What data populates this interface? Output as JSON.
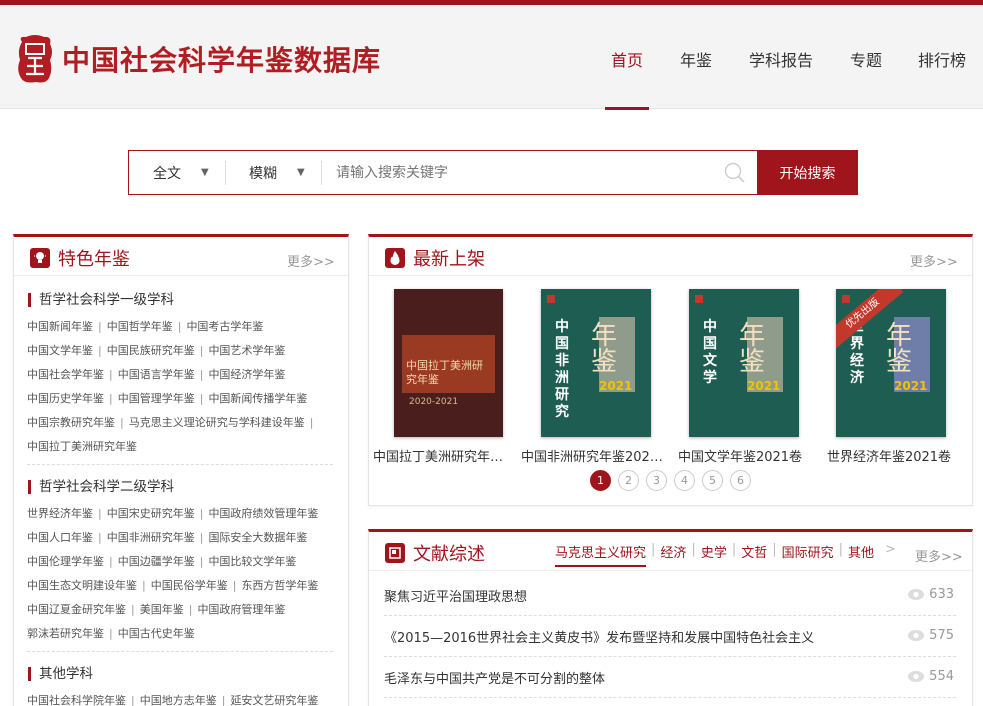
{
  "brand": {
    "name": "中国社会科学年鉴数据库",
    "color": "#a0141b"
  },
  "nav": [
    {
      "label": "首页",
      "active": true
    },
    {
      "label": "年鉴",
      "active": false
    },
    {
      "label": "学科报告",
      "active": false
    },
    {
      "label": "专题",
      "active": false
    },
    {
      "label": "排行榜",
      "active": false
    }
  ],
  "search": {
    "scope": "全文",
    "match": "模糊",
    "placeholder": "请输入搜索关键字",
    "button": "开始搜索"
  },
  "featured": {
    "title": "特色年鉴",
    "more": "更多>>",
    "groups": [
      {
        "title": "哲学社会科学一级学科",
        "lines": [
          [
            "中国新闻年鉴",
            "中国哲学年鉴",
            "中国考古学年鉴"
          ],
          [
            "中国文学年鉴",
            "中国民族研究年鉴",
            "中国艺术学年鉴"
          ],
          [
            "中国社会学年鉴",
            "中国语言学年鉴",
            "中国经济学年鉴"
          ],
          [
            "中国历史学年鉴",
            "中国管理学年鉴",
            "中国新闻传播学年鉴"
          ],
          [
            "中国宗教研究年鉴",
            "马克思主义理论研究与学科建设年鉴",
            ""
          ],
          [
            "中国拉丁美洲研究年鉴"
          ]
        ]
      },
      {
        "title": "哲学社会科学二级学科",
        "lines": [
          [
            "世界经济年鉴",
            "中国宋史研究年鉴",
            "中国政府绩效管理年鉴"
          ],
          [
            "中国人口年鉴",
            "中国非洲研究年鉴",
            "国际安全大数据年鉴"
          ],
          [
            "中国伦理学年鉴",
            "中国边疆学年鉴",
            "中国比较文学年鉴"
          ],
          [
            "中国生态文明建设年鉴",
            "中国民俗学年鉴",
            "东西方哲学年鉴"
          ],
          [
            "中国辽夏金研究年鉴",
            "美国年鉴",
            "中国政府管理年鉴"
          ],
          [
            "郭沫若研究年鉴",
            "中国古代史年鉴"
          ]
        ]
      },
      {
        "title": "其他学科",
        "lines": [
          [
            "中国社会科学院年鉴",
            "中国地方志年鉴",
            "延安文艺研究年鉴"
          ]
        ]
      }
    ]
  },
  "newest": {
    "title": "最新上架",
    "more": "更多>>",
    "books": [
      {
        "title": "中国拉丁美洲研究年鉴...",
        "cover_text": "中国拉丁美洲研究年鉴",
        "cover_year": "2020-2021",
        "cover_color": "#4a1e1c"
      },
      {
        "title": "中国非洲研究年鉴2021...",
        "cover_text": "中国非洲研究",
        "cover_big": "年鉴",
        "cover_year": "2021",
        "cover_color": "#1e5e52"
      },
      {
        "title": "中国文学年鉴2021卷",
        "cover_text": "中国文学",
        "cover_big": "年鉴",
        "cover_year": "2021",
        "cover_color": "#1e5e52"
      },
      {
        "title": "世界经济年鉴2021卷",
        "cover_text": "世界经济",
        "cover_big": "年鉴",
        "cover_year": "2021",
        "cover_color": "#1e5e52",
        "ribbon": "优先出版"
      }
    ],
    "pages": [
      "1",
      "2",
      "3",
      "4",
      "5",
      "6"
    ],
    "current_page": 1
  },
  "literature": {
    "title": "文献综述",
    "more": "更多>>",
    "tabs": [
      "马克思主义研究",
      "经济",
      "史学",
      "文哲",
      "国际研究",
      "其他"
    ],
    "active_tab": 0,
    "arrow": ">",
    "items": [
      {
        "title": "聚焦习近平治国理政思想",
        "views": "633"
      },
      {
        "title": "《2015—2016世界社会主义黄皮书》发布暨坚持和发展中国特色社会主义",
        "views": "575"
      },
      {
        "title": "毛泽东与中国共产党是不可分割的整体",
        "views": "554"
      }
    ]
  }
}
